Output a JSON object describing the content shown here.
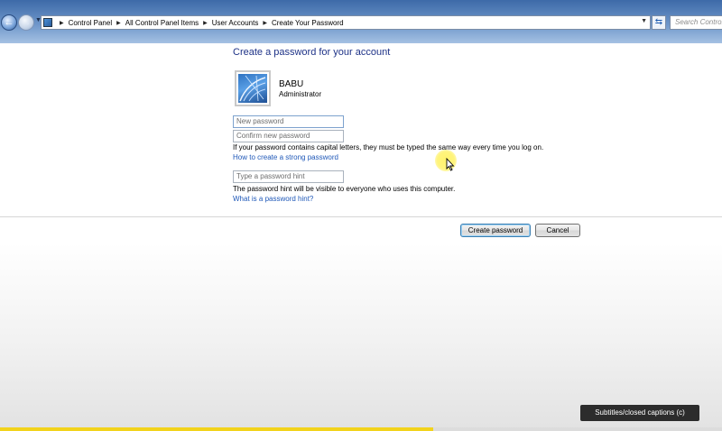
{
  "address_bar": {
    "breadcrumbs": [
      "Control Panel",
      "All Control Panel Items",
      "User Accounts",
      "Create Your Password"
    ],
    "search_placeholder": "Search Control Panel"
  },
  "page": {
    "title": "Create a password for your account"
  },
  "user": {
    "name": "BABU",
    "role": "Administrator"
  },
  "form": {
    "new_password_placeholder": "New password",
    "confirm_password_placeholder": "Confirm new password",
    "caps_note": "If your password contains capital letters, they must be typed the same way every time you log on.",
    "strong_password_link": "How to create a strong password",
    "hint_placeholder": "Type a password hint",
    "hint_note": "The password hint will be visible to everyone who uses this computer.",
    "hint_link": "What is a password hint?"
  },
  "buttons": {
    "create": "Create password",
    "cancel": "Cancel"
  },
  "video": {
    "caption_tooltip": "Subtitles/closed captions (c)",
    "progress_fraction": 0.6,
    "progress_color": "#f2d31c"
  },
  "colors": {
    "title": "#1e3287",
    "link": "#1f58b8"
  },
  "icons": [
    "back-arrow-icon",
    "forward-arrow-icon",
    "control-panel-icon",
    "refresh-icon",
    "user-avatar-icon",
    "cursor-icon"
  ]
}
